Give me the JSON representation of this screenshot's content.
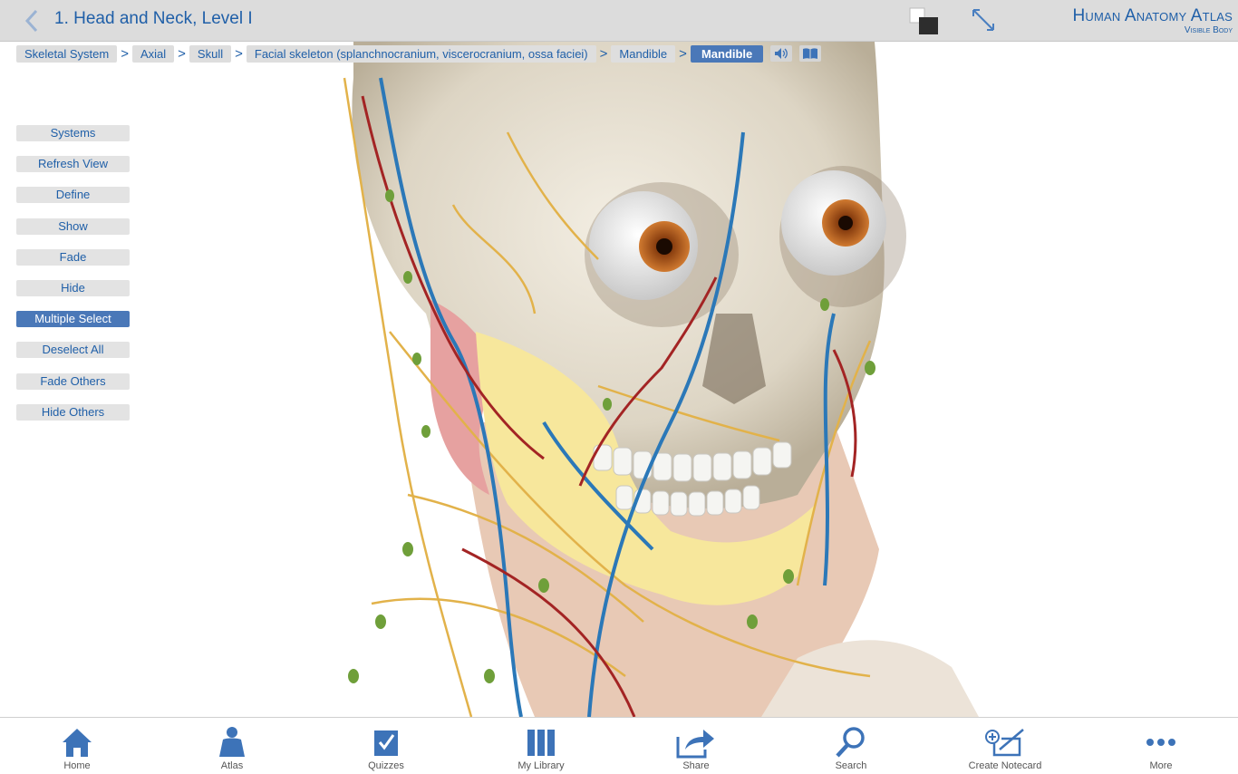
{
  "header": {
    "title": "1. Head and Neck, Level I",
    "brand_name": "Human Anatomy Atlas",
    "brand_sub": "Visible Body"
  },
  "breadcrumb": {
    "items": [
      "Skeletal System",
      "Axial",
      "Skull",
      "Facial skeleton (splanchnocranium, viscerocranium, ossa faciei)",
      "Mandible"
    ],
    "current": "Mandible",
    "separator": ">"
  },
  "tools": {
    "items": [
      "Systems",
      "Refresh View",
      "Define",
      "Show",
      "Fade",
      "Hide",
      "Multiple Select",
      "Deselect All",
      "Fade Others",
      "Hide Others"
    ],
    "selected": "Multiple Select"
  },
  "tabbar": {
    "items": [
      {
        "label": "Home",
        "icon": "home-icon"
      },
      {
        "label": "Atlas",
        "icon": "person-icon"
      },
      {
        "label": "Quizzes",
        "icon": "checkbox-icon"
      },
      {
        "label": "My Library",
        "icon": "library-icon"
      },
      {
        "label": "Share",
        "icon": "share-icon"
      },
      {
        "label": "Search",
        "icon": "search-icon"
      },
      {
        "label": "Create Notecard",
        "icon": "notecard-icon"
      },
      {
        "label": "More",
        "icon": "more-icon"
      }
    ]
  },
  "colors": {
    "accent": "#1f5fa8",
    "selected": "#4a78b8",
    "header_bg": "#dcdcdc",
    "icon": "#3d73b8"
  }
}
